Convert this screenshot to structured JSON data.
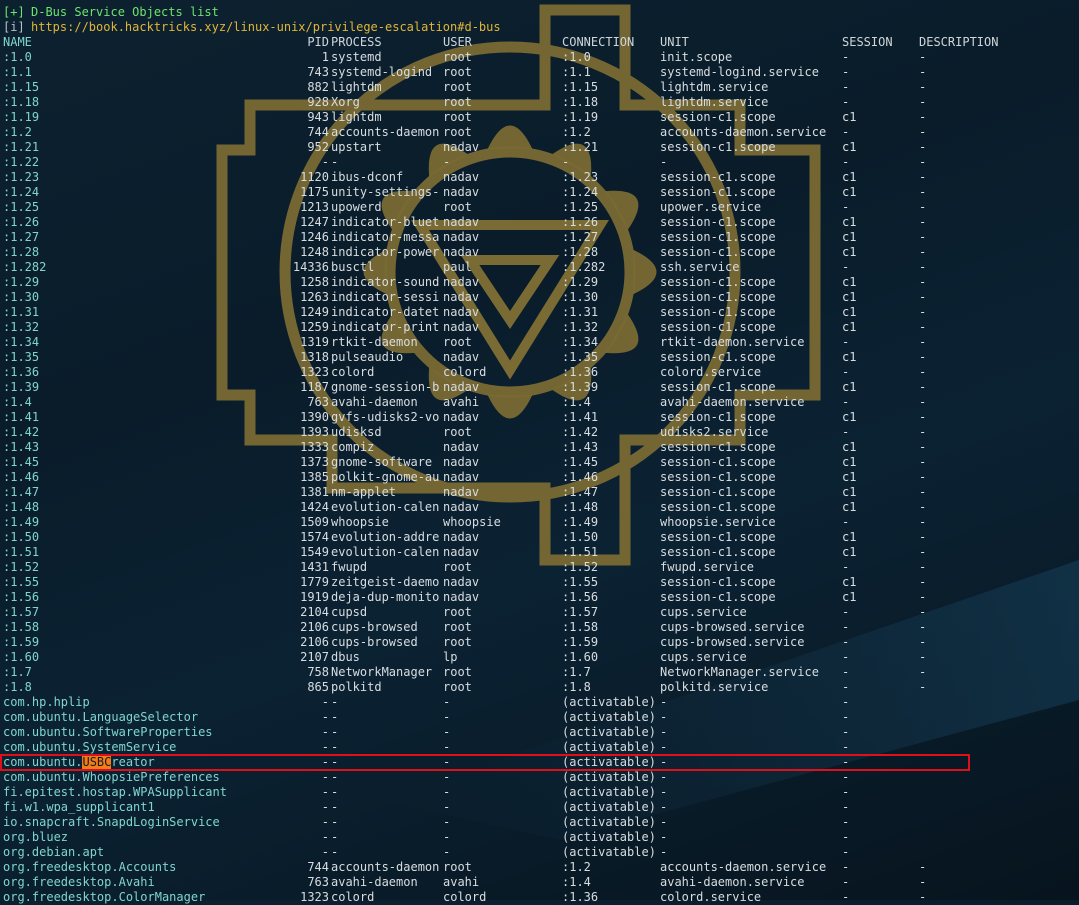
{
  "header": {
    "title_prefix": "[+]",
    "title": "D-Bus Service Objects list",
    "info_prefix": "[i]",
    "url": "https://book.hacktricks.xyz/linux-unix/privilege-escalation#d-bus"
  },
  "columns": {
    "name": "NAME",
    "pid": "PID",
    "process": "PROCESS",
    "user": "USER",
    "connection": "CONNECTION",
    "unit": "UNIT",
    "session": "SESSION",
    "description": "DESCRIPTION"
  },
  "highlight": {
    "before": "com.ubuntu.",
    "match": "USBC",
    "after": "reator"
  },
  "rows": [
    [
      ":1.0",
      "1",
      "systemd",
      "root",
      ":1.0",
      "init.scope",
      "-",
      "-"
    ],
    [
      ":1.1",
      "743",
      "systemd-logind",
      "root",
      ":1.1",
      "systemd-logind.service",
      "-",
      "-"
    ],
    [
      ":1.15",
      "882",
      "lightdm",
      "root",
      ":1.15",
      "lightdm.service",
      "-",
      "-"
    ],
    [
      ":1.18",
      "928",
      "Xorg",
      "root",
      ":1.18",
      "lightdm.service",
      "-",
      "-"
    ],
    [
      ":1.19",
      "943",
      "lightdm",
      "root",
      ":1.19",
      "session-c1.scope",
      "c1",
      "-"
    ],
    [
      ":1.2",
      "744",
      "accounts-daemon",
      "root",
      ":1.2",
      "accounts-daemon.service",
      "-",
      "-"
    ],
    [
      ":1.21",
      "952",
      "upstart",
      "nadav",
      ":1.21",
      "session-c1.scope",
      "c1",
      "-"
    ],
    [
      ":1.22",
      "-",
      "-",
      "-",
      "-",
      "-",
      "-",
      "-"
    ],
    [
      ":1.23",
      "1120",
      "ibus-dconf",
      "nadav",
      ":1.23",
      "session-c1.scope",
      "c1",
      "-"
    ],
    [
      ":1.24",
      "1175",
      "unity-settings-",
      "nadav",
      ":1.24",
      "session-c1.scope",
      "c1",
      "-"
    ],
    [
      ":1.25",
      "1213",
      "upowerd",
      "root",
      ":1.25",
      "upower.service",
      "-",
      "-"
    ],
    [
      ":1.26",
      "1247",
      "indicator-bluet",
      "nadav",
      ":1.26",
      "session-c1.scope",
      "c1",
      "-"
    ],
    [
      ":1.27",
      "1246",
      "indicator-messa",
      "nadav",
      ":1.27",
      "session-c1.scope",
      "c1",
      "-"
    ],
    [
      ":1.28",
      "1248",
      "indicator-power",
      "nadav",
      ":1.28",
      "session-c1.scope",
      "c1",
      "-"
    ],
    [
      ":1.282",
      "14336",
      "busctl",
      "paul",
      ":1.282",
      "ssh.service",
      "-",
      "-"
    ],
    [
      ":1.29",
      "1258",
      "indicator-sound",
      "nadav",
      ":1.29",
      "session-c1.scope",
      "c1",
      "-"
    ],
    [
      ":1.30",
      "1263",
      "indicator-sessi",
      "nadav",
      ":1.30",
      "session-c1.scope",
      "c1",
      "-"
    ],
    [
      ":1.31",
      "1249",
      "indicator-datet",
      "nadav",
      ":1.31",
      "session-c1.scope",
      "c1",
      "-"
    ],
    [
      ":1.32",
      "1259",
      "indicator-print",
      "nadav",
      ":1.32",
      "session-c1.scope",
      "c1",
      "-"
    ],
    [
      ":1.34",
      "1319",
      "rtkit-daemon",
      "root",
      ":1.34",
      "rtkit-daemon.service",
      "-",
      "-"
    ],
    [
      ":1.35",
      "1318",
      "pulseaudio",
      "nadav",
      ":1.35",
      "session-c1.scope",
      "c1",
      "-"
    ],
    [
      ":1.36",
      "1323",
      "colord",
      "colord",
      ":1.36",
      "colord.service",
      "-",
      "-"
    ],
    [
      ":1.39",
      "1187",
      "gnome-session-b",
      "nadav",
      ":1.39",
      "session-c1.scope",
      "c1",
      "-"
    ],
    [
      ":1.4",
      "763",
      "avahi-daemon",
      "avahi",
      ":1.4",
      "avahi-daemon.service",
      "-",
      "-"
    ],
    [
      ":1.41",
      "1390",
      "gvfs-udisks2-vo",
      "nadav",
      ":1.41",
      "session-c1.scope",
      "c1",
      "-"
    ],
    [
      ":1.42",
      "1393",
      "udisksd",
      "root",
      ":1.42",
      "udisks2.service",
      "-",
      "-"
    ],
    [
      ":1.43",
      "1333",
      "compiz",
      "nadav",
      ":1.43",
      "session-c1.scope",
      "c1",
      "-"
    ],
    [
      ":1.45",
      "1373",
      "gnome-software",
      "nadav",
      ":1.45",
      "session-c1.scope",
      "c1",
      "-"
    ],
    [
      ":1.46",
      "1385",
      "polkit-gnome-au",
      "nadav",
      ":1.46",
      "session-c1.scope",
      "c1",
      "-"
    ],
    [
      ":1.47",
      "1381",
      "nm-applet",
      "nadav",
      ":1.47",
      "session-c1.scope",
      "c1",
      "-"
    ],
    [
      ":1.48",
      "1424",
      "evolution-calen",
      "nadav",
      ":1.48",
      "session-c1.scope",
      "c1",
      "-"
    ],
    [
      ":1.49",
      "1509",
      "whoopsie",
      "whoopsie",
      ":1.49",
      "whoopsie.service",
      "-",
      "-"
    ],
    [
      ":1.50",
      "1574",
      "evolution-addre",
      "nadav",
      ":1.50",
      "session-c1.scope",
      "c1",
      "-"
    ],
    [
      ":1.51",
      "1549",
      "evolution-calen",
      "nadav",
      ":1.51",
      "session-c1.scope",
      "c1",
      "-"
    ],
    [
      ":1.52",
      "1431",
      "fwupd",
      "root",
      ":1.52",
      "fwupd.service",
      "-",
      "-"
    ],
    [
      ":1.55",
      "1779",
      "zeitgeist-daemo",
      "nadav",
      ":1.55",
      "session-c1.scope",
      "c1",
      "-"
    ],
    [
      ":1.56",
      "1919",
      "deja-dup-monito",
      "nadav",
      ":1.56",
      "session-c1.scope",
      "c1",
      "-"
    ],
    [
      ":1.57",
      "2104",
      "cupsd",
      "root",
      ":1.57",
      "cups.service",
      "-",
      "-"
    ],
    [
      ":1.58",
      "2106",
      "cups-browsed",
      "root",
      ":1.58",
      "cups-browsed.service",
      "-",
      "-"
    ],
    [
      ":1.59",
      "2106",
      "cups-browsed",
      "root",
      ":1.59",
      "cups-browsed.service",
      "-",
      "-"
    ],
    [
      ":1.60",
      "2107",
      "dbus",
      "lp",
      ":1.60",
      "cups.service",
      "-",
      "-"
    ],
    [
      ":1.7",
      "758",
      "NetworkManager",
      "root",
      ":1.7",
      "NetworkManager.service",
      "-",
      "-"
    ],
    [
      ":1.8",
      "865",
      "polkitd",
      "root",
      ":1.8",
      "polkitd.service",
      "-",
      "-"
    ],
    [
      "com.hp.hplip",
      "-",
      "-",
      "-",
      "(activatable)",
      "-",
      "-",
      ""
    ],
    [
      "com.ubuntu.LanguageSelector",
      "-",
      "-",
      "-",
      "(activatable)",
      "-",
      "-",
      ""
    ],
    [
      "com.ubuntu.SoftwareProperties",
      "-",
      "-",
      "-",
      "(activatable)",
      "-",
      "-",
      ""
    ],
    [
      "com.ubuntu.SystemService",
      "-",
      "-",
      "-",
      "(activatable)",
      "-",
      "-",
      ""
    ],
    [
      "com.ubuntu.USBCreator",
      "-",
      "-",
      "-",
      "(activatable)",
      "-",
      "-",
      ""
    ],
    [
      "com.ubuntu.WhoopsiePreferences",
      "-",
      "-",
      "-",
      "(activatable)",
      "-",
      "-",
      ""
    ],
    [
      "fi.epitest.hostap.WPASupplicant",
      "-",
      "-",
      "-",
      "(activatable)",
      "-",
      "-",
      ""
    ],
    [
      "fi.w1.wpa_supplicant1",
      "-",
      "-",
      "-",
      "(activatable)",
      "-",
      "-",
      ""
    ],
    [
      "io.snapcraft.SnapdLoginService",
      "-",
      "-",
      "-",
      "(activatable)",
      "-",
      "-",
      ""
    ],
    [
      "org.bluez",
      "-",
      "-",
      "-",
      "(activatable)",
      "-",
      "-",
      ""
    ],
    [
      "org.debian.apt",
      "-",
      "-",
      "-",
      "(activatable)",
      "-",
      "-",
      ""
    ],
    [
      "org.freedesktop.Accounts",
      "744",
      "accounts-daemon",
      "root",
      ":1.2",
      "accounts-daemon.service",
      "-",
      "-"
    ],
    [
      "org.freedesktop.Avahi",
      "763",
      "avahi-daemon",
      "avahi",
      ":1.4",
      "avahi-daemon.service",
      "-",
      "-"
    ],
    [
      "org.freedesktop.ColorManager",
      "1323",
      "colord",
      "colord",
      ":1.36",
      "colord.service",
      "-",
      "-"
    ]
  ]
}
